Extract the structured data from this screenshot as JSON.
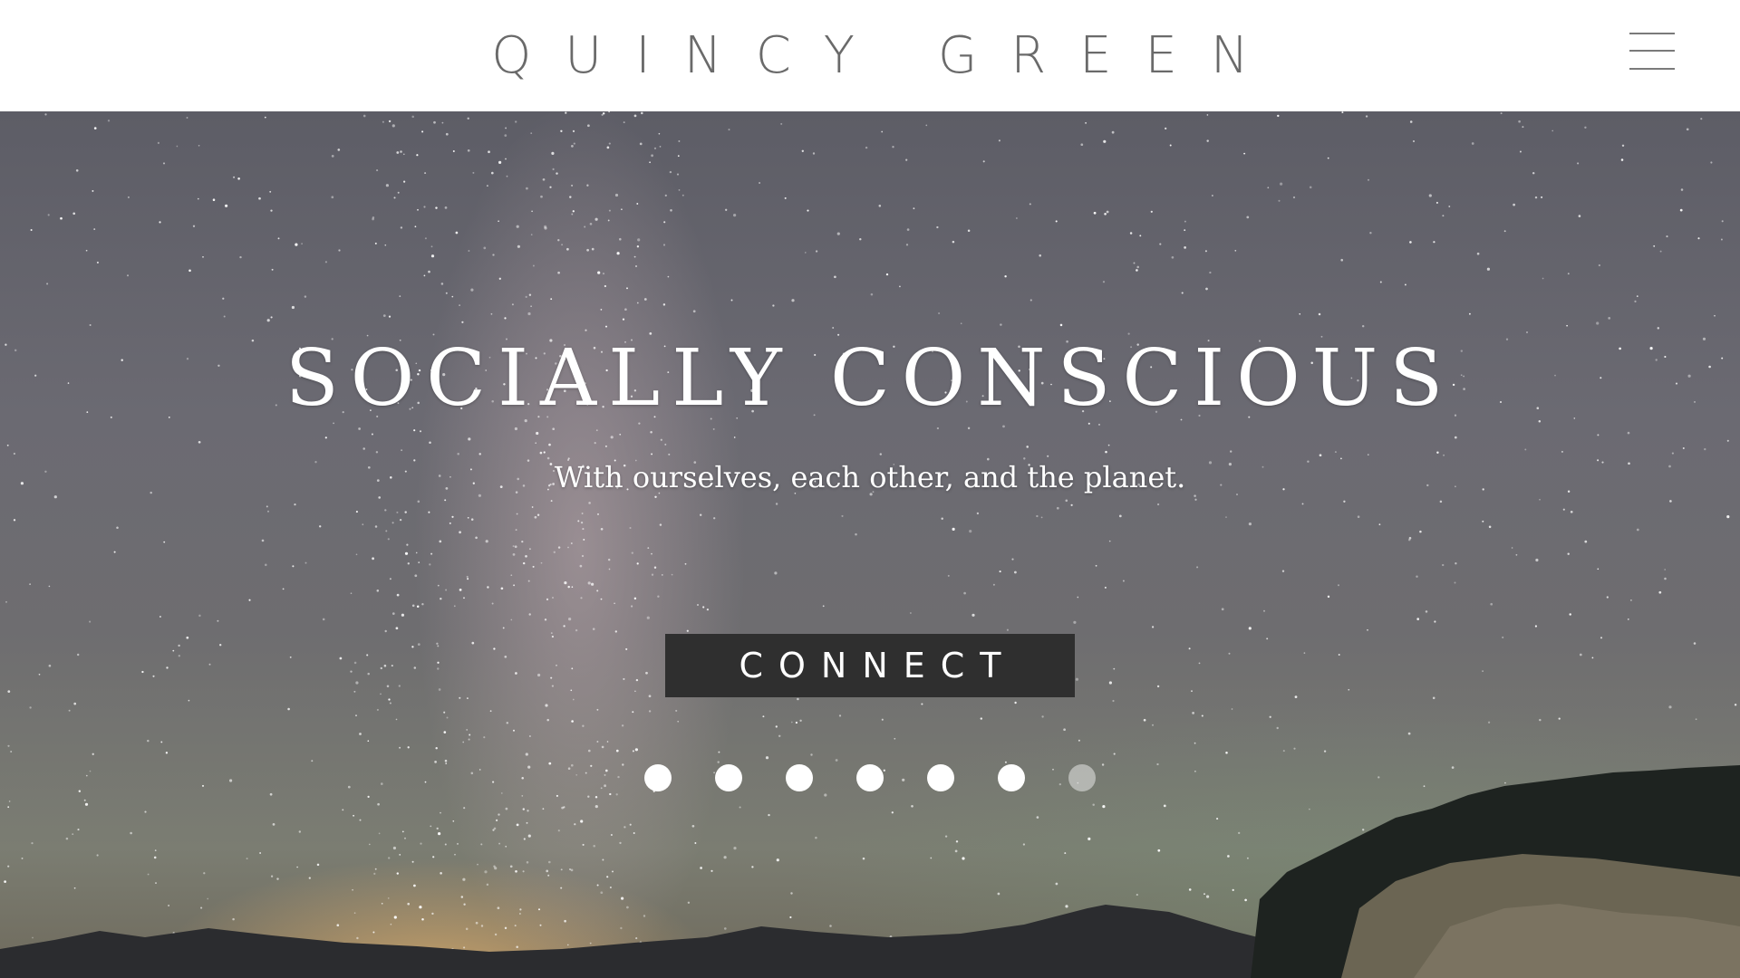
{
  "header": {
    "brand": "QUINCY GREEN",
    "menu_icon": "hamburger-menu-icon"
  },
  "hero": {
    "title": "SOCIALLY CONSCIOUS",
    "subtitle": "With ourselves, each other, and the planet.",
    "cta_label": "CONNECT",
    "slide_count": 7,
    "active_slides": [
      true,
      true,
      true,
      true,
      true,
      true,
      false
    ],
    "background": "starry night sky with milky way over mountain silhouette"
  },
  "colors": {
    "brand_text": "#6a6a6a",
    "button_bg": "#2f2f2f",
    "hero_text": "#ffffff"
  }
}
